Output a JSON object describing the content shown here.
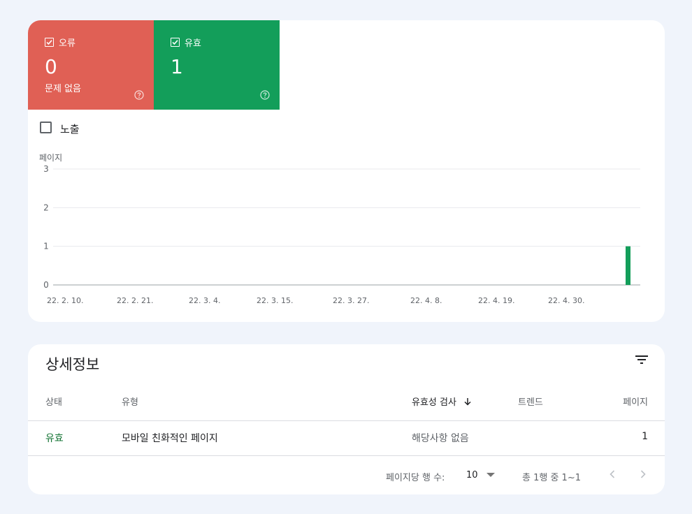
{
  "tiles": {
    "error": {
      "label": "오류",
      "count": "0",
      "sub": "문제 없음",
      "color": "#e06055",
      "checked": true
    },
    "valid": {
      "label": "유효",
      "count": "1",
      "color": "#139e5a",
      "checked": true
    }
  },
  "impressions": {
    "label": "노출",
    "checked": false
  },
  "chart_data": {
    "type": "bar",
    "ylabel": "페이지",
    "ylim": [
      0,
      3
    ],
    "yticks": [
      "0",
      "1",
      "2",
      "3"
    ],
    "x_tick_labels": [
      "22. 2. 10.",
      "22. 2. 21.",
      "22. 3. 4.",
      "22. 3. 15.",
      "22. 3. 27.",
      "22. 4. 8.",
      "22. 4. 19.",
      "22. 4. 30."
    ],
    "series": [
      {
        "name": "유효",
        "color": "#139e5a",
        "points": [
          {
            "x": "22. 5. 11.",
            "y": 1
          }
        ]
      }
    ],
    "grid": true
  },
  "details": {
    "title": "상세정보",
    "columns": {
      "status": "상태",
      "type": "유형",
      "validation": "유효성 검사",
      "trend": "트렌드",
      "pages": "페이지"
    },
    "rows": [
      {
        "status": "유효",
        "type": "모바일 친화적인 페이지",
        "validation": "해당사항 없음",
        "pages": "1"
      }
    ],
    "footer": {
      "rows_per_page_label": "페이지당 행 수:",
      "rows_per_page": "10",
      "range": "총 1행 중 1~1"
    }
  }
}
